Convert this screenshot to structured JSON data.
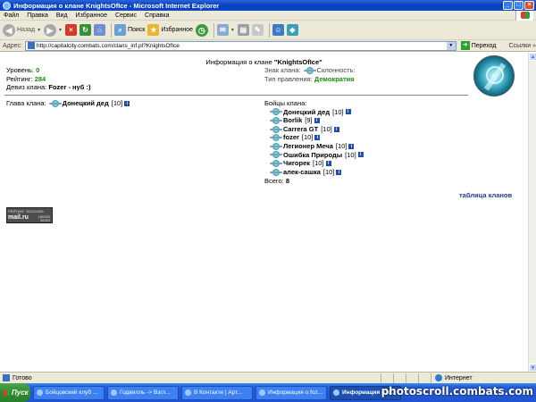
{
  "window": {
    "title": "Информация о клане KnightsOfIce - Microsoft Internet Explorer",
    "buttons": {
      "minimize": "_",
      "maximize": "□",
      "close": "×"
    }
  },
  "menu": [
    "Файл",
    "Правка",
    "Вид",
    "Избранное",
    "Сервис",
    "Справка"
  ],
  "toolbar": {
    "back": "Назад",
    "search": "Поиск",
    "favorites": "Избранное"
  },
  "address": {
    "label": "Адрес:",
    "url": "http://capitalcity.combats.com/clans_inf.pl?KnightsOfIce",
    "go": "Переход",
    "links": "Ссылки »"
  },
  "page": {
    "title_prefix": "Информация о клане",
    "clan_name": "\"KnightsOfIce\"",
    "level_label": "Уровень:",
    "level_value": "0",
    "rating_label": "Рейтинг:",
    "rating_value": "284",
    "motto_label": "Девиз клана:",
    "motto_value": "Fozer - нуб :)",
    "emblem_label": "Знак клана:",
    "alignment_label": "Склонность:",
    "gov_label": "Тип правления:",
    "gov_value": "Демократия",
    "head_label": "Глава клана:",
    "head_name": "Донецкий дед",
    "head_level": "[10]",
    "fighters_label": "Бойцы клана:",
    "fighters": [
      {
        "name": "Донецкий дед",
        "level": "[10]"
      },
      {
        "name": "Borlik",
        "level": "[9]"
      },
      {
        "name": "Carrera GT",
        "level": "[10]"
      },
      {
        "name": "fozer",
        "level": "[10]"
      },
      {
        "name": "Легионер Меча",
        "level": "[10]"
      },
      {
        "name": "Ошибка Природы",
        "level": "[10]"
      },
      {
        "name": "Чигорек",
        "level": "[10]"
      },
      {
        "name": "алек-сашка",
        "level": "[10]"
      }
    ],
    "total_label": "Всего:",
    "total_value": "8",
    "clan_table_link": "таблица кланов",
    "counter": {
      "line1": "РЕЙТИНГ 261321366",
      "brand": "mail.ru",
      "line2": "180926",
      "line3": "30083"
    }
  },
  "status": {
    "text": "Готово",
    "zone": "Интернет"
  },
  "taskbar": {
    "start": "Пуск",
    "tasks": [
      {
        "label": "Бойцовский клуб ...",
        "active": false
      },
      {
        "label": "Годвилль -> Взгл...",
        "active": false
      },
      {
        "label": "В Контакте | Арт...",
        "active": false
      },
      {
        "label": "Информация о foz...",
        "active": false
      },
      {
        "label": "Информация о к...",
        "active": true
      }
    ],
    "watermark": "photoscroll.combats.com"
  }
}
